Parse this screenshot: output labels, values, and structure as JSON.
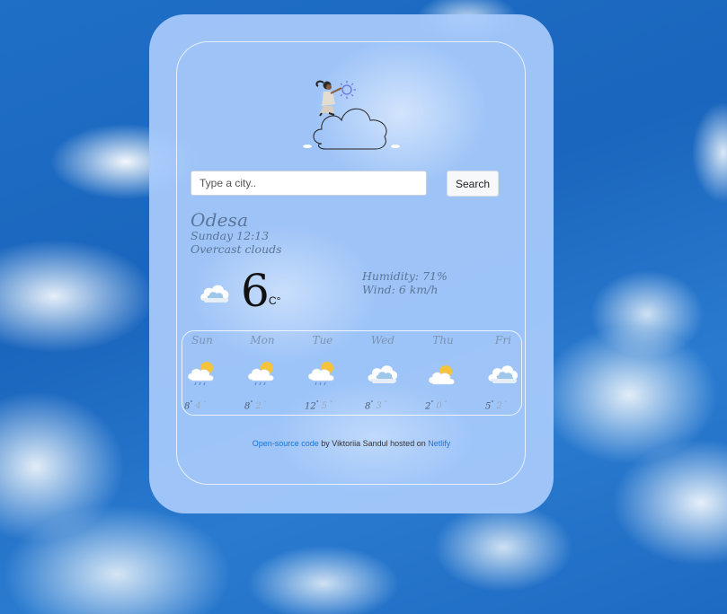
{
  "search": {
    "placeholder": "Type a city..",
    "button_label": "Search"
  },
  "current": {
    "city": "Odesa",
    "datetime": "Sunday 12:13",
    "description": "Overcast clouds",
    "temperature": "6",
    "unit": "C°",
    "icon": "cloud-icon",
    "humidity": "Humidity: 71%",
    "wind": "Wind: 6 km/h"
  },
  "forecast": [
    {
      "day": "Sun",
      "max": "8",
      "min": "4",
      "icon": "sun-cloud-rain-icon"
    },
    {
      "day": "Mon",
      "max": "8",
      "min": "2",
      "icon": "sun-cloud-rain-icon"
    },
    {
      "day": "Tue",
      "max": "12",
      "min": "5",
      "icon": "sun-cloud-rain-icon"
    },
    {
      "day": "Wed",
      "max": "8",
      "min": "3",
      "icon": "cloud-icon"
    },
    {
      "day": "Thu",
      "max": "2",
      "min": "0",
      "icon": "sun-cloud-icon"
    },
    {
      "day": "Fri",
      "max": "5",
      "min": "2",
      "icon": "cloud-icon"
    }
  ],
  "footer": {
    "link_code": "Open-source code",
    "text_by": " by Viktoriia Sandul hosted on ",
    "link_host": "Netlify"
  },
  "colors": {
    "card": "#a8cbfc",
    "link": "#1a73d9",
    "script_text": "#5a7698"
  }
}
